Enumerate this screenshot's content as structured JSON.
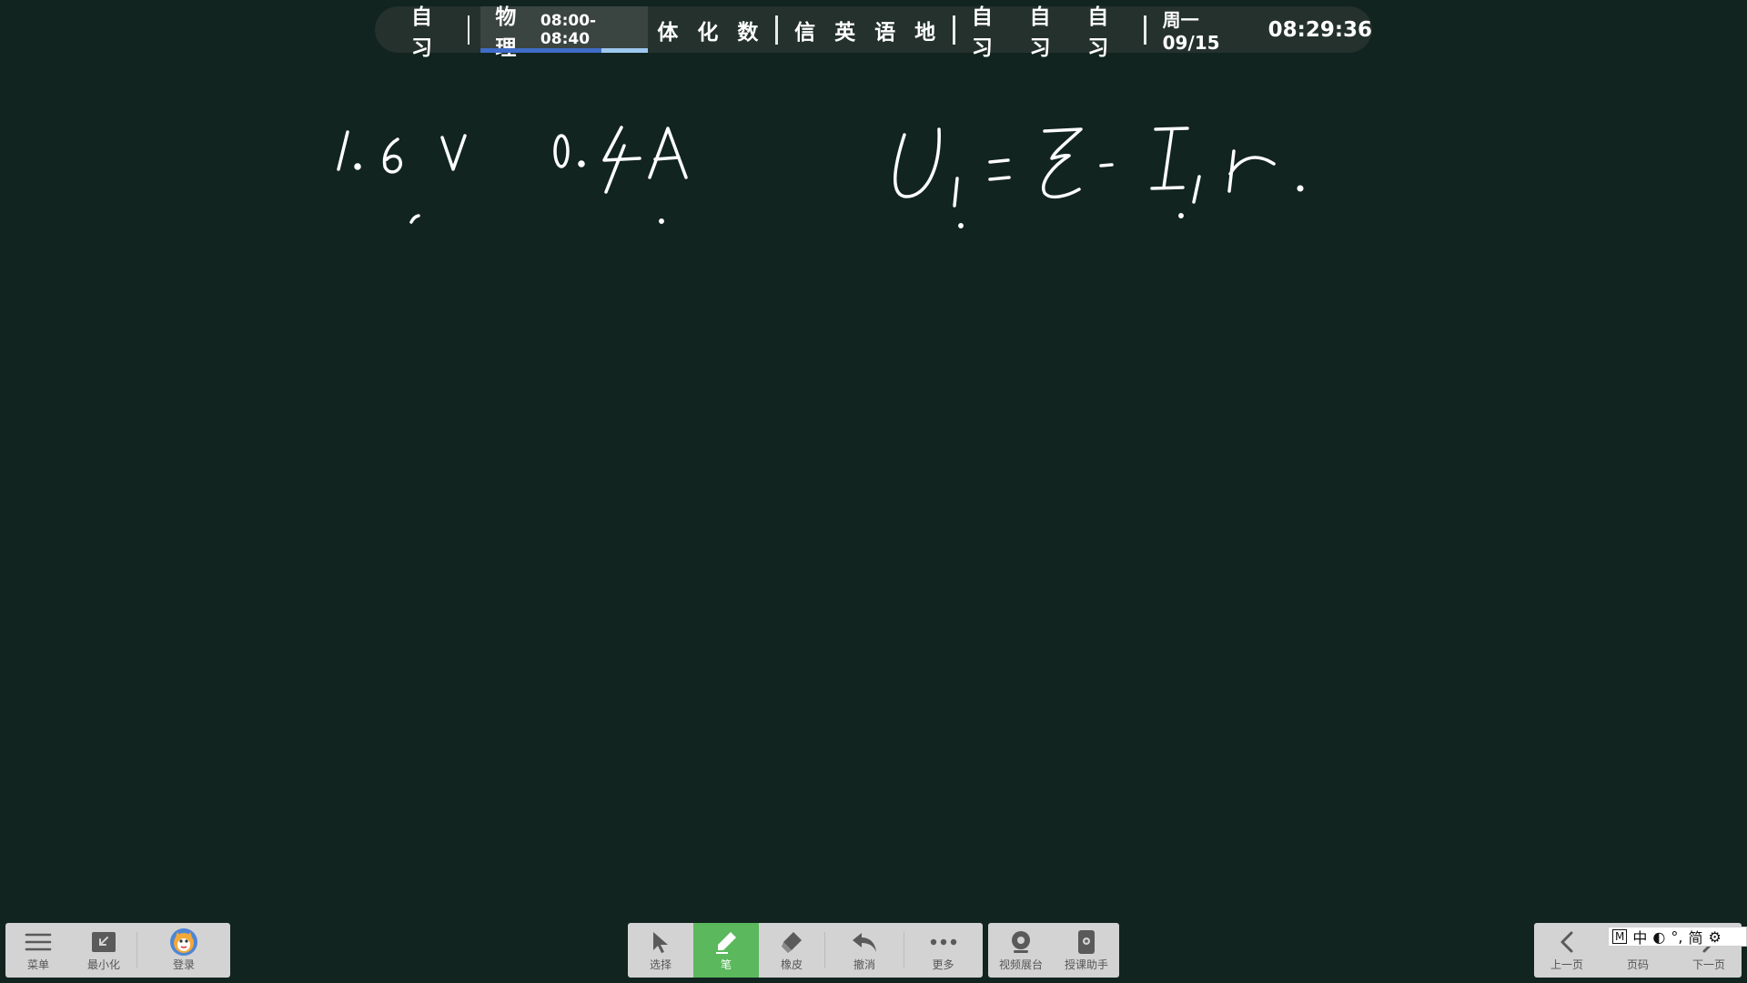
{
  "schedule": {
    "items": [
      {
        "type": "class",
        "label": "自习"
      },
      {
        "type": "sep"
      },
      {
        "type": "current",
        "label": "物理",
        "time": "08:00-08:40",
        "progress": 0.72
      },
      {
        "type": "class",
        "label": "体"
      },
      {
        "type": "class",
        "label": "化"
      },
      {
        "type": "class",
        "label": "数"
      },
      {
        "type": "sep"
      },
      {
        "type": "class",
        "label": "信"
      },
      {
        "type": "class",
        "label": "英"
      },
      {
        "type": "class",
        "label": "语"
      },
      {
        "type": "class",
        "label": "地"
      },
      {
        "type": "sep"
      },
      {
        "type": "class",
        "label": "自习"
      },
      {
        "type": "class",
        "label": "自习"
      },
      {
        "type": "class",
        "label": "自习"
      },
      {
        "type": "sep"
      }
    ],
    "date": "周一 09/15",
    "clock": "08:29:36"
  },
  "board": {
    "ink_color": "#ffffff",
    "handwriting": [
      "1.6V",
      "0.4A",
      "U1 = E - I1 r"
    ]
  },
  "toolbar_left": {
    "menu_label": "菜单",
    "minimize_label": "最小化",
    "login_label": "登录"
  },
  "toolbar_center": {
    "select_label": "选择",
    "pen_label": "笔",
    "eraser_label": "橡皮",
    "undo_label": "撤消",
    "more_label": "更多",
    "video_label": "视频展台",
    "assistant_label": "授课助手"
  },
  "toolbar_right": {
    "prev_label": "上一页",
    "page_label": "页码",
    "next_label": "下一页"
  },
  "ime": {
    "mode_box": "M",
    "lang": "中",
    "width_glyph": "◐",
    "punct": "°,",
    "script": "简",
    "settings_icon": "⚙"
  },
  "colors": {
    "board_bg": "#11241f",
    "active_tool": "#5bb85d",
    "progress_done": "#3f6cc7",
    "progress_remaining": "#9ec8ee"
  }
}
